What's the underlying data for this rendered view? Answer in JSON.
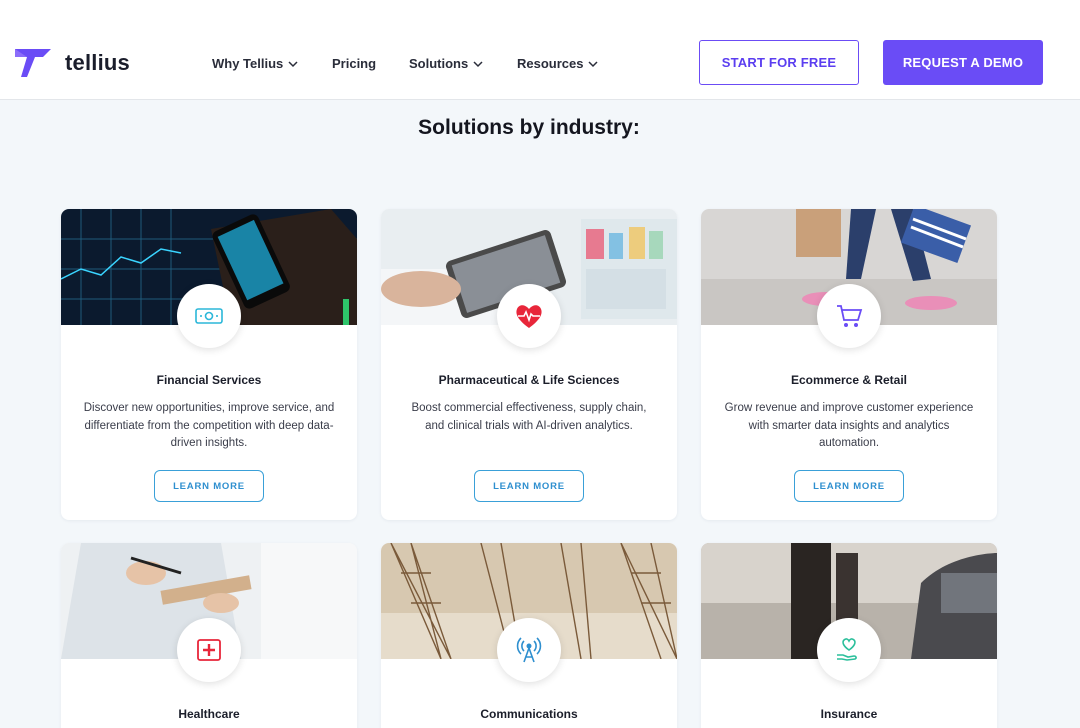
{
  "brand": {
    "name": "tellius",
    "color": "#6a4cf6"
  },
  "nav": {
    "items": [
      {
        "label": "Why Tellius",
        "has_dropdown": true
      },
      {
        "label": "Pricing",
        "has_dropdown": false
      },
      {
        "label": "Solutions",
        "has_dropdown": true
      },
      {
        "label": "Resources",
        "has_dropdown": true
      }
    ],
    "start_free_label": "START FOR FREE",
    "request_demo_label": "REQUEST A DEMO"
  },
  "section": {
    "title": "Solutions by industry:"
  },
  "cards": [
    {
      "title": "Financial Services",
      "description": "Discover new opportunities, improve service, and differentiate from the competition with deep data-driven insights.",
      "button": "LEARN MORE",
      "icon": "money-icon",
      "icon_color": "#2bb7d9"
    },
    {
      "title": "Pharmaceutical & Life Sciences",
      "description": "Boost commercial effectiveness, supply chain, and clinical trials with AI-driven analytics.",
      "button": "LEARN MORE",
      "icon": "heartbeat-icon",
      "icon_color": "#e8263a"
    },
    {
      "title": "Ecommerce & Retail",
      "description": "Grow revenue and improve customer experience with smarter data insights and analytics automation.",
      "button": "LEARN MORE",
      "icon": "cart-icon",
      "icon_color": "#6a4cf6"
    },
    {
      "title": "Healthcare",
      "icon": "medical-cross-icon",
      "icon_color": "#e8263a"
    },
    {
      "title": "Communications",
      "icon": "antenna-icon",
      "icon_color": "#2e8fcf"
    },
    {
      "title": "Insurance",
      "icon": "heart-hand-icon",
      "icon_color": "#2bbf9b"
    }
  ]
}
